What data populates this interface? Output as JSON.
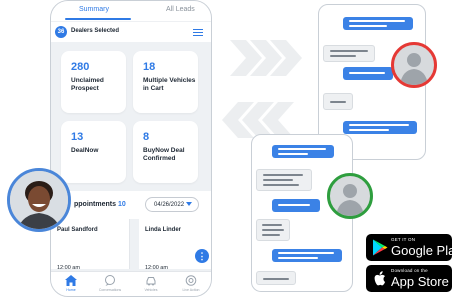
{
  "app": {
    "tabs": [
      "Summary",
      "All Leads"
    ],
    "dealers": {
      "count": "36",
      "label": "Dealers Selected"
    },
    "cards": [
      {
        "value": "280",
        "label": "Unclaimed Prospect"
      },
      {
        "value": "18",
        "label": "Multiple Vehicles in Cart"
      },
      {
        "value": "13",
        "label": "DealNow"
      },
      {
        "value": "8",
        "label": "BuyNow Deal Confirmed"
      }
    ],
    "appointments": {
      "title": "ppointments",
      "count": "10",
      "date": "04/26/2022"
    },
    "appointment_cards": [
      {
        "name": "Paul Sandford",
        "time": "12:00 am"
      },
      {
        "name": "Linda Linder",
        "time": "12:00 am"
      }
    ],
    "fab_label": "⋮",
    "nav": [
      "Home",
      "Conversations",
      "Vehicles",
      "Live Action"
    ]
  },
  "badges": {
    "google": {
      "small": "GET IT ON",
      "big": "Google Play"
    },
    "apple": {
      "small": "Download on the",
      "big": "App Store"
    }
  },
  "colors": {
    "accent": "#2f7ae5",
    "red_ring": "#e53935",
    "green_ring": "#2e9e3e"
  }
}
